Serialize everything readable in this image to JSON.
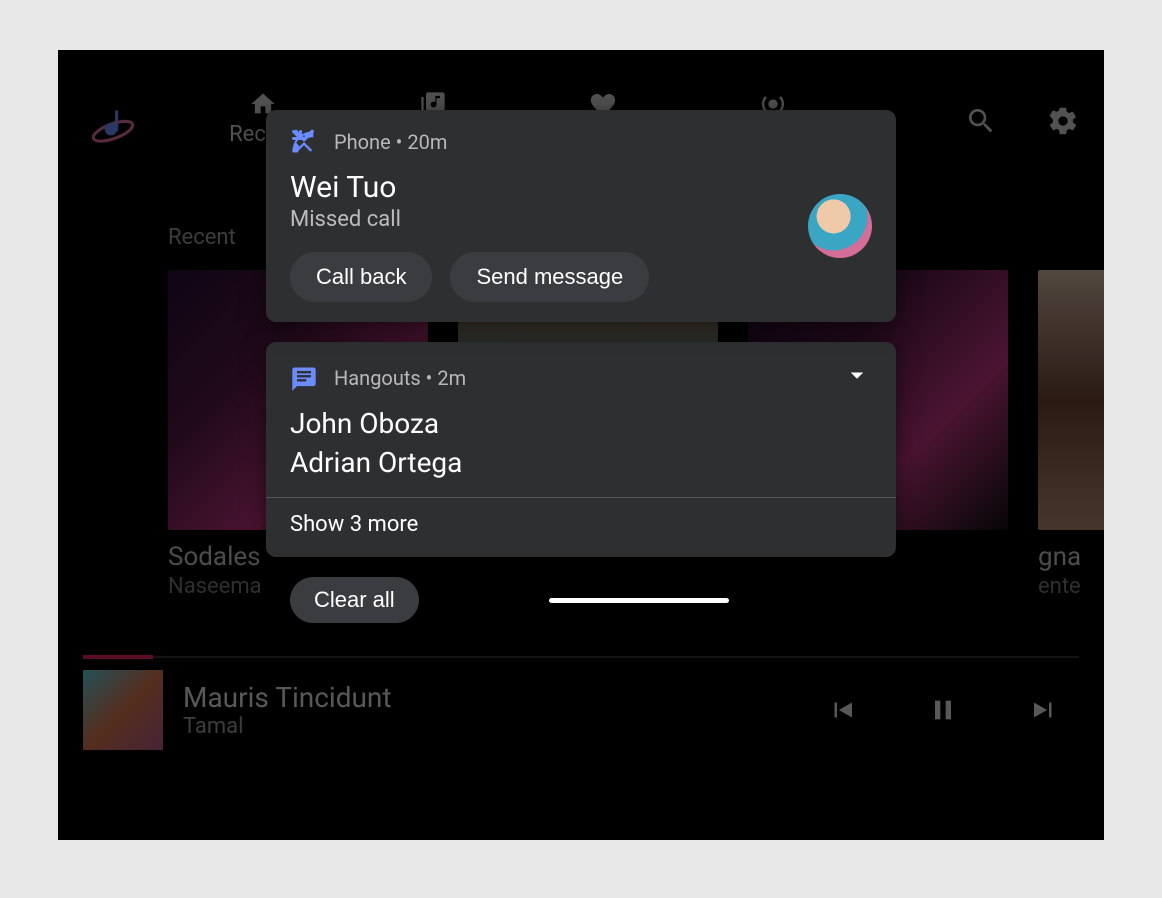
{
  "nav": {
    "tabs": [
      {
        "label": "Recent"
      }
    ],
    "sectionLabel": "Recent"
  },
  "albums": [
    {
      "title": "Sodales",
      "artist": "Naseema"
    },
    {
      "title": "",
      "artist": ""
    },
    {
      "title": "",
      "artist": ""
    },
    {
      "title": "gna",
      "artist": "ente"
    }
  ],
  "nowPlaying": {
    "title": "Mauris Tincidunt",
    "artist": "Tamal"
  },
  "notifications": {
    "phone": {
      "app": "Phone",
      "time": "20m",
      "headerText": "Phone • 20m",
      "contact": "Wei Tuo",
      "subtitle": "Missed call",
      "actions": {
        "callBack": "Call back",
        "sendMessage": "Send message"
      }
    },
    "hangouts": {
      "app": "Hangouts",
      "time": "2m",
      "headerText": "Hangouts • 2m",
      "names": [
        "John Oboza",
        "Adrian Ortega"
      ],
      "showMore": "Show 3 more"
    },
    "clearAll": "Clear all"
  },
  "colors": {
    "cardBg": "#2d2f31",
    "accentBlue": "#6b8cff"
  }
}
